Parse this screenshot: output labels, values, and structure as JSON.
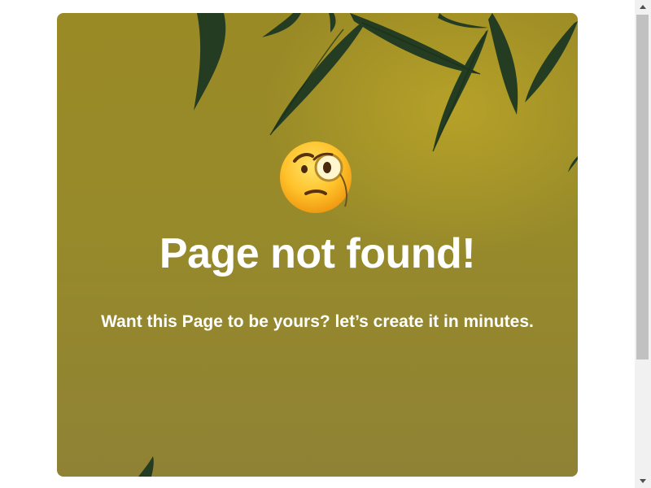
{
  "card": {
    "emoji": "face-with-monocle",
    "title": "Page not found!",
    "subtitle": "Want this Page to be yours? let’s create it in minutes."
  },
  "colors": {
    "card_background": "#978a2a",
    "leaf": "#243d22",
    "text": "#ffffff",
    "scrollbar_track": "#f1f1f1",
    "scrollbar_thumb": "#c1c1c1"
  },
  "icons": {
    "hero": "face-with-monocle-icon",
    "scroll_up": "scroll-up-arrow-icon",
    "scroll_down": "scroll-down-arrow-icon"
  }
}
